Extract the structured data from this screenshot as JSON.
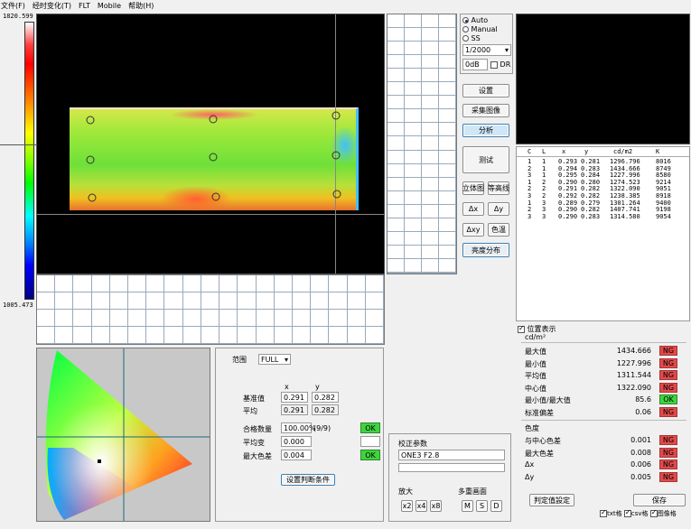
{
  "menu": [
    "文件(F)",
    "经时变化(T)",
    "FLT",
    "Mobile",
    "帮助(H)"
  ],
  "scale": {
    "max": "1820.599",
    "min": "1005.473"
  },
  "exposure": {
    "modes": [
      "Auto",
      "Manual",
      "SS"
    ],
    "shutter": "1/2000",
    "gain": "0dB",
    "dr_label": "DR"
  },
  "buttons": {
    "settings": "设置",
    "capture": "采集图像",
    "analyze": "分析",
    "measure": "测试",
    "view3d": "立体图",
    "contour": "等高线",
    "dx": "Δx",
    "dy": "Δy",
    "dxy": "Δxy",
    "color_temp": "色温",
    "brightness_dist": "亮度分布",
    "set_judge": "设置判断条件",
    "judge_setting": "判定值設定",
    "save": "保存",
    "zoom_x2": "x2",
    "zoom_x4": "x4",
    "zoom_x8": "x8",
    "multi_m": "M",
    "multi_s": "S",
    "multi_d": "D"
  },
  "table": {
    "headers": [
      "C",
      "L",
      "x",
      "y",
      "cd/m2",
      "K"
    ],
    "rows": [
      [
        "1",
        "1",
        "0.293",
        "0.281",
        "1296.796",
        "8016"
      ],
      [
        "2",
        "1",
        "0.294",
        "0.283",
        "1434.666",
        "8749"
      ],
      [
        "3",
        "1",
        "0.295",
        "0.284",
        "1227.996",
        "8580"
      ],
      [
        "1",
        "2",
        "0.290",
        "0.280",
        "1274.523",
        "9214"
      ],
      [
        "2",
        "2",
        "0.291",
        "0.282",
        "1322.090",
        "9051"
      ],
      [
        "3",
        "2",
        "0.292",
        "0.282",
        "1238.385",
        "8918"
      ],
      [
        "1",
        "3",
        "0.289",
        "0.279",
        "1301.264",
        "9400"
      ],
      [
        "2",
        "3",
        "0.290",
        "0.282",
        "1407.741",
        "9198"
      ],
      [
        "3",
        "3",
        "0.290",
        "0.283",
        "1314.580",
        "9054"
      ]
    ]
  },
  "position_display": "位置表示",
  "unit": "cd/m²",
  "stats": [
    {
      "label": "最大值",
      "value": "1434.666",
      "status": "NG"
    },
    {
      "label": "最小值",
      "value": "1227.996",
      "status": "NG"
    },
    {
      "label": "平均值",
      "value": "1311.544",
      "status": "NG"
    },
    {
      "label": "中心值",
      "value": "1322.090",
      "status": "NG"
    },
    {
      "label": "最小值/最大值",
      "value": "85.6",
      "status": "OK"
    },
    {
      "label": "标准偏差",
      "value": "0.06",
      "status": "NG"
    }
  ],
  "chroma_title": "色度",
  "chroma": [
    {
      "label": "与中心色差",
      "value": "0.001",
      "status": "NG"
    },
    {
      "label": "最大色差",
      "value": "0.008",
      "status": "NG"
    },
    {
      "label": "Δx",
      "value": "0.006",
      "status": "NG"
    },
    {
      "label": "Δy",
      "value": "0.005",
      "status": "NG"
    }
  ],
  "bottom_checks": [
    "txt格",
    "csv格",
    "图像格"
  ],
  "judge": {
    "range_label": "范围",
    "range_value": "FULL",
    "col_x": "x",
    "col_y": "y",
    "ref_label": "基准值",
    "ref_x": "0.291",
    "ref_y": "0.282",
    "avg_label": "平均",
    "avg_x": "0.291",
    "avg_y": "0.282",
    "pass_label": "合格数量",
    "pass_value": "100.00%",
    "pass_count": "(9/9)",
    "pass_status": "OK",
    "avg_var_label": "平均变",
    "avg_var_value": "0.000",
    "max_diff_label": "最大色差",
    "max_diff_value": "0.004",
    "max_diff_status": "OK"
  },
  "calibration": {
    "title": "校正参数",
    "value": "ONE3 F2.8",
    "zoom_label": "放大",
    "multi_label": "多重画面"
  },
  "colors": {
    "ng": "#e04a4a",
    "ok": "#3fd43f",
    "accent": "#3c7fb1"
  }
}
